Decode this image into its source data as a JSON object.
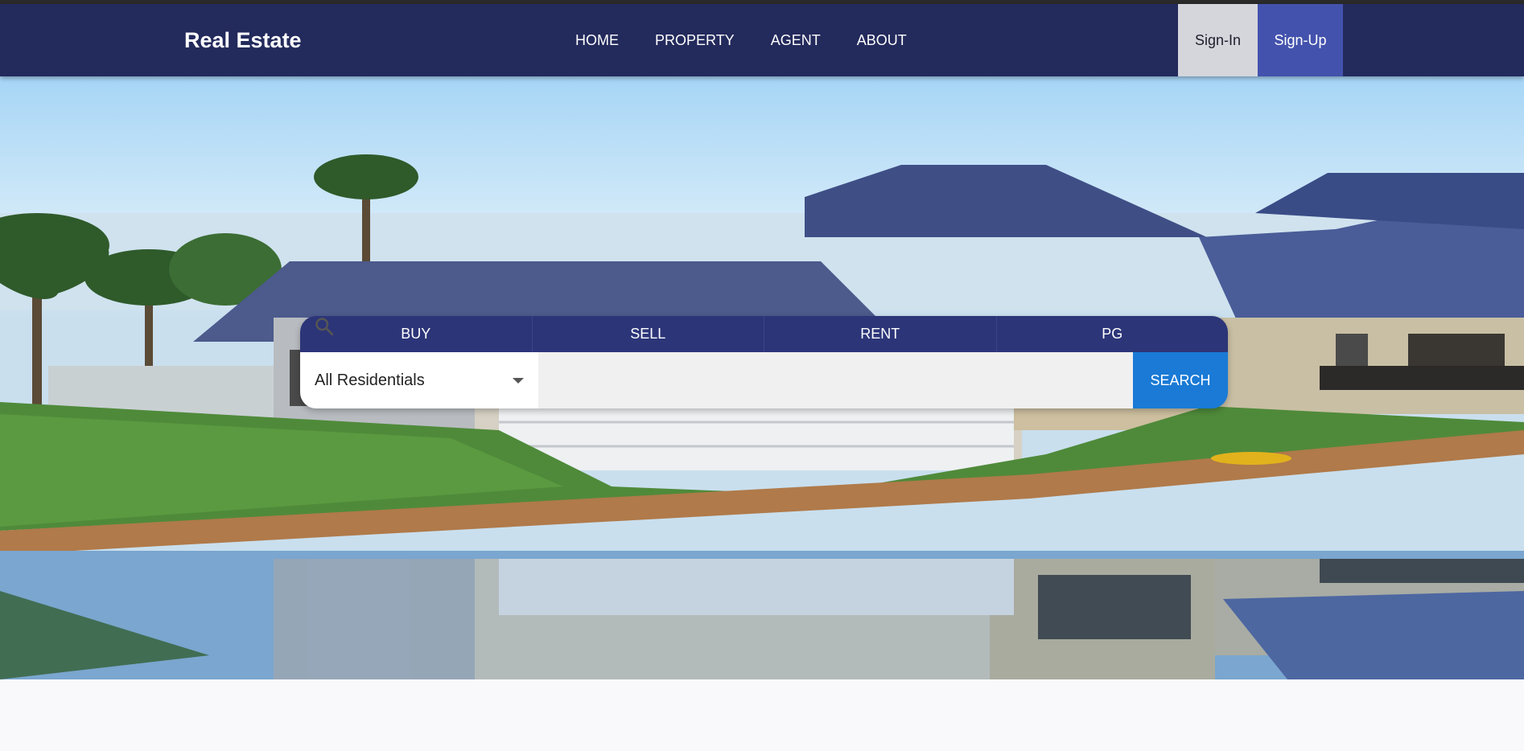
{
  "header": {
    "brand": "Real Estate",
    "nav": [
      {
        "label": "HOME"
      },
      {
        "label": "PROPERTY"
      },
      {
        "label": "AGENT"
      },
      {
        "label": "ABOUT"
      }
    ],
    "sign_in": "Sign-In",
    "sign_up": "Sign-Up"
  },
  "search": {
    "tabs": [
      {
        "label": "BUY"
      },
      {
        "label": "SELL"
      },
      {
        "label": "RENT"
      },
      {
        "label": "PG"
      }
    ],
    "category_selected": "All Residentials",
    "query": "",
    "button_label": "SEARCH"
  },
  "icons": {
    "search": "search-icon",
    "dropdown": "chevron-down-icon"
  },
  "colors": {
    "navbar": "#232a5c",
    "tab_bar": "#2c3578",
    "sign_up": "#4352ad",
    "sign_in": "#d5d6dc",
    "search_button": "#1a7ad6"
  }
}
